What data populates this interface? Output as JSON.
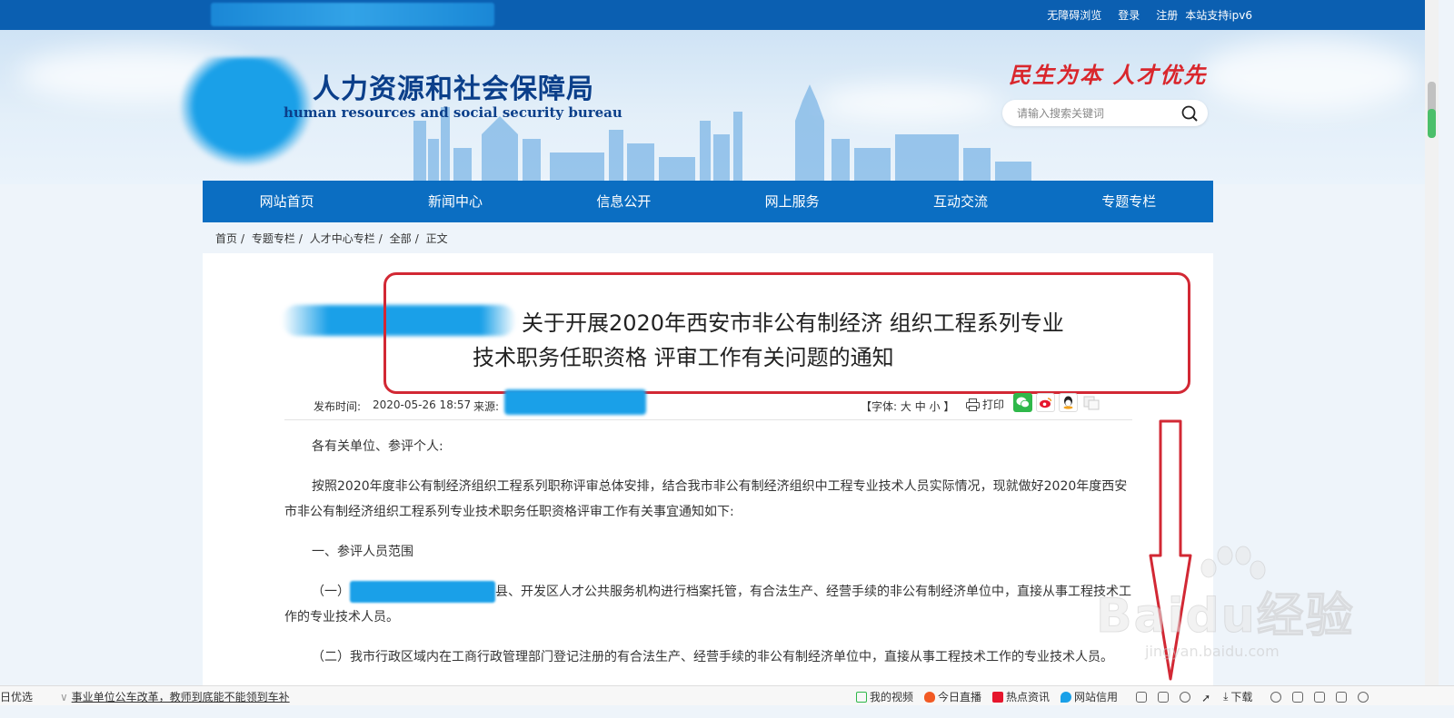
{
  "topbar": {
    "links": [
      "无障碍浏览",
      "登录",
      "注册",
      "本站支持ipv6"
    ]
  },
  "header": {
    "title": "人力资源和社会保障局",
    "subtitle": "human resources and social security bureau",
    "slogan": "民生为本 人才优先",
    "search_placeholder": "请输入搜索关键词"
  },
  "nav": {
    "items": [
      "网站首页",
      "新闻中心",
      "信息公开",
      "网上服务",
      "互动交流",
      "专题专栏"
    ]
  },
  "breadcrumb": [
    "首页",
    "专题专栏",
    "人才中心专栏",
    "全部",
    "正文"
  ],
  "article": {
    "title_line1": "关于开展2020年西安市非公有制经济 组织工程系列专业",
    "title_line2": "技术职务任职资格 评审工作有关问题的通知",
    "date_label": "发布时间:",
    "date": "2020-05-26 18:57",
    "source_label": "来源:",
    "fontsize_label": "【字体:",
    "fontsize_large": "大",
    "fontsize_medium": "中",
    "fontsize_small": "小",
    "fontsize_end": "】",
    "print_label": "打印",
    "paragraphs": {
      "p1": "各有关单位、参评个人:",
      "p2": "按照2020年度非公有制经济组织工程系列职称评审总体安排，结合我市非公有制经济组织中工程专业技术人员实际情况，现就做好2020年度西安市非公有制经济组织工程系列专业技术职务任职资格评审工作有关事宜通知如下:",
      "p3": "一、参评人员范围",
      "p4_prefix": "（一）",
      "p4_text": "县、开发区人才公共服务机构进行档案托管，有合法生产、经营手续的非公有制经济单位中，直接从事工程技术工作的专业技术人员。",
      "p5": "（二）我市行政区域内在工商行政管理部门登记注册的有合法生产、经营手续的非公有制经济单位中，直接从事工程技术工作的专业技术人员。"
    }
  },
  "watermark": {
    "text": "Baidu经验",
    "url": "jingyan.baidu.com"
  },
  "statusbar": {
    "left_label": "日优选",
    "news": "事业单位公车改革，教师到底能不能领到车补",
    "items": [
      "我的视频",
      "今日直播",
      "热点资讯",
      "网站信用"
    ],
    "download": "下载"
  },
  "colors": {
    "nav_blue": "#0b6ec2",
    "topbar_blue": "#0b5fb1",
    "annotation_red": "#d22834",
    "slogan_red": "#d9262c"
  }
}
